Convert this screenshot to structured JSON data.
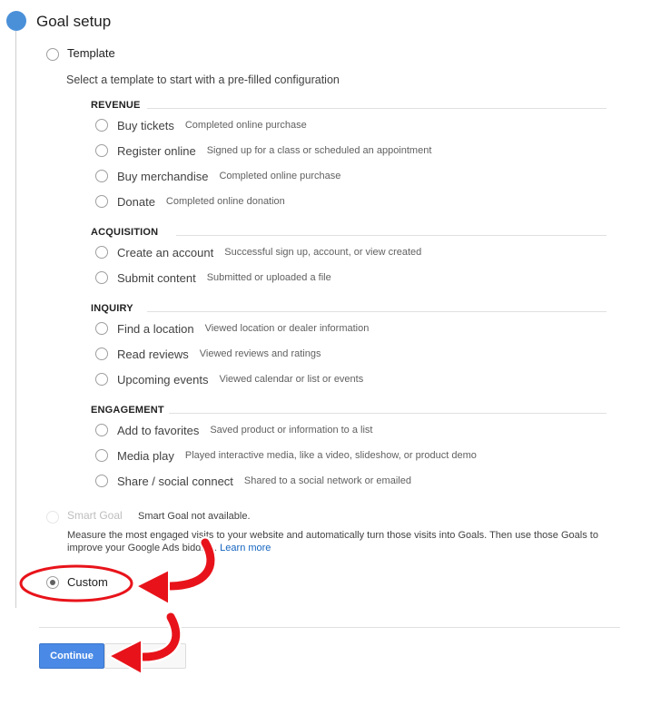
{
  "step": {
    "title": "Goal setup"
  },
  "template": {
    "label": "Template",
    "description": "Select a template to start with a pre-filled configuration",
    "categories": [
      {
        "name": "REVENUE",
        "items": [
          {
            "label": "Buy tickets",
            "hint": "Completed online purchase"
          },
          {
            "label": "Register online",
            "hint": "Signed up for a class or scheduled an appointment"
          },
          {
            "label": "Buy merchandise",
            "hint": "Completed online purchase"
          },
          {
            "label": "Donate",
            "hint": "Completed online donation"
          }
        ]
      },
      {
        "name": "ACQUISITION",
        "items": [
          {
            "label": "Create an account",
            "hint": "Successful sign up, account, or view created"
          },
          {
            "label": "Submit content",
            "hint": "Submitted or uploaded a file"
          }
        ]
      },
      {
        "name": "INQUIRY",
        "items": [
          {
            "label": "Find a location",
            "hint": "Viewed location or dealer information"
          },
          {
            "label": "Read reviews",
            "hint": "Viewed reviews and ratings"
          },
          {
            "label": "Upcoming events",
            "hint": "Viewed calendar or list or events"
          }
        ]
      },
      {
        "name": "ENGAGEMENT",
        "items": [
          {
            "label": "Add to favorites",
            "hint": "Saved product or information to a list"
          },
          {
            "label": "Media play",
            "hint": "Played interactive media, like a video, slideshow, or product demo"
          },
          {
            "label": "Share / social connect",
            "hint": "Shared to a social network or emailed"
          }
        ]
      }
    ]
  },
  "smart_goal": {
    "label": "Smart Goal",
    "note": "Smart Goal not available.",
    "description_line1": "Measure the most engaged visits to your website and automatically turn those visits into Goals. Then use those Goals to",
    "description_line2": "improve your Google Ads bidding.",
    "learn_more": "Learn more"
  },
  "custom": {
    "label": "Custom",
    "selected": true
  },
  "actions": {
    "continue_label": "Continue"
  },
  "colors": {
    "accent": "#4a8ae6",
    "annotation": "#e8131a"
  }
}
